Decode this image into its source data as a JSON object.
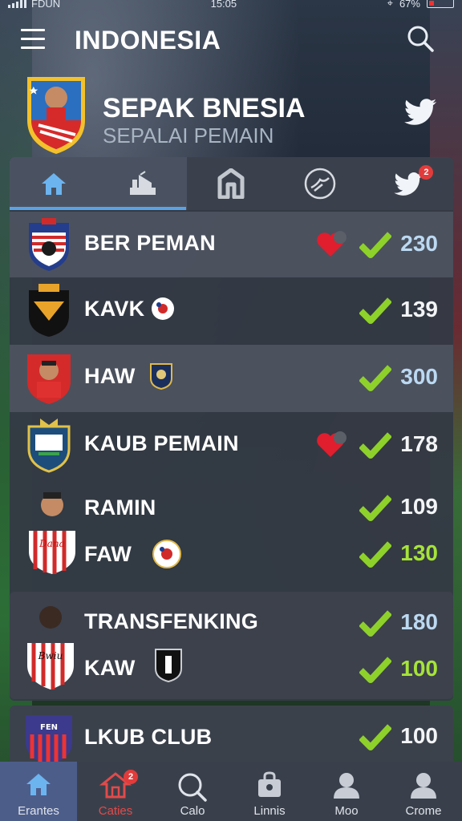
{
  "status_bar": {
    "carrier": "FDUN",
    "time": "15:05",
    "battery": "67%"
  },
  "app_bar": {
    "title": "INDONESIA"
  },
  "team": {
    "name": "SEPAK BNESIA",
    "subtitle": "SEPALAI PEMAIN"
  },
  "tabs": [
    {
      "icon": "home-icon",
      "active": true
    },
    {
      "icon": "stadium-icon"
    },
    {
      "icon": "transfer-icon"
    },
    {
      "icon": "whistle-icon"
    },
    {
      "icon": "twitter-icon",
      "badge": "2"
    }
  ],
  "rows": [
    {
      "label": "BER PEMAN",
      "heart": true,
      "count": "230",
      "count_color": "blue"
    },
    {
      "label": "KAVK",
      "count": "139",
      "count_color": "white"
    },
    {
      "label": "HAW",
      "count": "300",
      "count_color": "blue"
    },
    {
      "label": "KAUB PEMAIN",
      "heart": true,
      "count": "178",
      "count_color": "white"
    },
    {
      "label": "RAMIN",
      "count": "109",
      "count_color": "white"
    },
    {
      "label": "FAW",
      "count": "130",
      "count_color": "green"
    }
  ],
  "card2": [
    {
      "label": "TRANSFENKING",
      "count": "180",
      "count_color": "blue"
    },
    {
      "label": "KAW",
      "count": "100",
      "count_color": "green"
    }
  ],
  "card3": {
    "label": "LKUB CLUB",
    "count": "100",
    "count_color": "white"
  },
  "bottom_nav": [
    {
      "label": "Erantes",
      "icon": "home-icon",
      "active": true
    },
    {
      "label": "Caties",
      "icon": "house-alert-icon",
      "badge": "2",
      "red": true
    },
    {
      "label": "Calo",
      "icon": "search-icon"
    },
    {
      "label": "Linnis",
      "icon": "bag-icon"
    },
    {
      "label": "Moo",
      "icon": "user-icon"
    },
    {
      "label": "Crome",
      "icon": "profile-icon"
    }
  ],
  "colors": {
    "accent": "#5aa2e6",
    "check": "#8ed12a",
    "heart": "#e01e2e",
    "badge": "#e23b3b"
  }
}
